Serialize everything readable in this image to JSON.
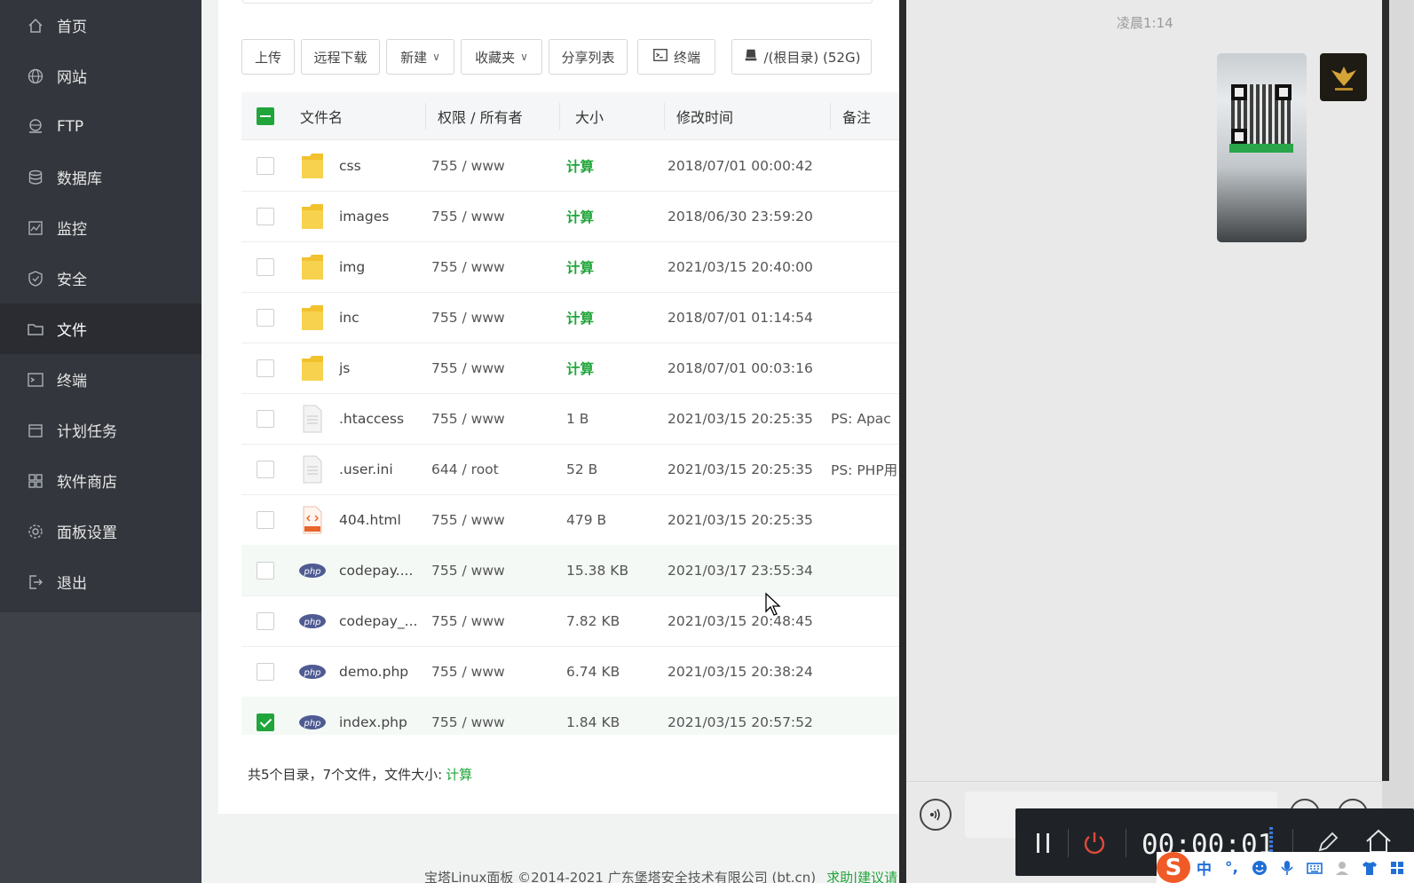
{
  "sidebar": {
    "items": [
      {
        "label": "首页",
        "icon": "home-icon",
        "active": false
      },
      {
        "label": "网站",
        "icon": "globe-icon",
        "active": false
      },
      {
        "label": "FTP",
        "icon": "ftp-icon",
        "active": false
      },
      {
        "label": "数据库",
        "icon": "database-icon",
        "active": false
      },
      {
        "label": "监控",
        "icon": "monitor-icon",
        "active": false
      },
      {
        "label": "安全",
        "icon": "shield-icon",
        "active": false
      },
      {
        "label": "文件",
        "icon": "folder-icon",
        "active": true
      },
      {
        "label": "终端",
        "icon": "terminal-icon",
        "active": false
      },
      {
        "label": "计划任务",
        "icon": "calendar-icon",
        "active": false
      },
      {
        "label": "软件商店",
        "icon": "apps-icon",
        "active": false
      },
      {
        "label": "面板设置",
        "icon": "gear-icon",
        "active": false
      },
      {
        "label": "退出",
        "icon": "logout-icon",
        "active": false
      }
    ]
  },
  "toolbar": {
    "upload": "上传",
    "remote_download": "远程下载",
    "new": "新建",
    "favorites": "收藏夹",
    "share_list": "分享列表",
    "terminal": "终端",
    "disk": "/(根目录) (52G)"
  },
  "table": {
    "headers": {
      "name": "文件名",
      "perm": "权限 / 所有者",
      "size": "大小",
      "mtime": "修改时间",
      "note": "备注"
    },
    "rows": [
      {
        "name": "css",
        "type": "folder",
        "perm": "755 / www",
        "size": "计算",
        "mtime": "2018/07/01 00:00:42",
        "note": "",
        "checked": false
      },
      {
        "name": "images",
        "type": "folder",
        "perm": "755 / www",
        "size": "计算",
        "mtime": "2018/06/30 23:59:20",
        "note": "",
        "checked": false
      },
      {
        "name": "img",
        "type": "folder",
        "perm": "755 / www",
        "size": "计算",
        "mtime": "2021/03/15 20:40:00",
        "note": "",
        "checked": false
      },
      {
        "name": "inc",
        "type": "folder",
        "perm": "755 / www",
        "size": "计算",
        "mtime": "2018/07/01 01:14:54",
        "note": "",
        "checked": false
      },
      {
        "name": "js",
        "type": "folder",
        "perm": "755 / www",
        "size": "计算",
        "mtime": "2018/07/01 00:03:16",
        "note": "",
        "checked": false
      },
      {
        "name": ".htaccess",
        "type": "text",
        "perm": "755 / www",
        "size": "1 B",
        "mtime": "2021/03/15 20:25:35",
        "note": "PS: Apac",
        "checked": false
      },
      {
        "name": ".user.ini",
        "type": "text",
        "perm": "644 / root",
        "size": "52 B",
        "mtime": "2021/03/15 20:25:35",
        "note": "PS: PHP用",
        "checked": false
      },
      {
        "name": "404.html",
        "type": "html",
        "perm": "755 / www",
        "size": "479 B",
        "mtime": "2021/03/15 20:25:35",
        "note": "",
        "checked": false
      },
      {
        "name": "codepay....",
        "type": "php",
        "perm": "755 / www",
        "size": "15.38 KB",
        "mtime": "2021/03/17 23:55:34",
        "note": "",
        "checked": false
      },
      {
        "name": "codepay_...",
        "type": "php",
        "perm": "755 / www",
        "size": "7.82 KB",
        "mtime": "2021/03/15 20:48:45",
        "note": "",
        "checked": false
      },
      {
        "name": "demo.php",
        "type": "php",
        "perm": "755 / www",
        "size": "6.74 KB",
        "mtime": "2021/03/15 20:38:24",
        "note": "",
        "checked": false
      },
      {
        "name": "index.php",
        "type": "php",
        "perm": "755 / www",
        "size": "1.84 KB",
        "mtime": "2021/03/15 20:57:52",
        "note": "",
        "checked": true
      }
    ]
  },
  "summary": {
    "text": "共5个目录，7个文件，文件大小:",
    "calc": "计算"
  },
  "footer": {
    "copyright": "宝塔Linux面板 ©2014-2021 广东堡塔安全技术有限公司 (bt.cn)",
    "help": "求助|建议请"
  },
  "chat": {
    "time": "凌晨1:14"
  },
  "recorder": {
    "time": "00:00:01"
  },
  "ime": {
    "mode": "中",
    "punct": "°,"
  },
  "colors": {
    "accent": "#20a53a",
    "sidebar": "#33363c",
    "sidebar_active": "#2a2c31"
  }
}
